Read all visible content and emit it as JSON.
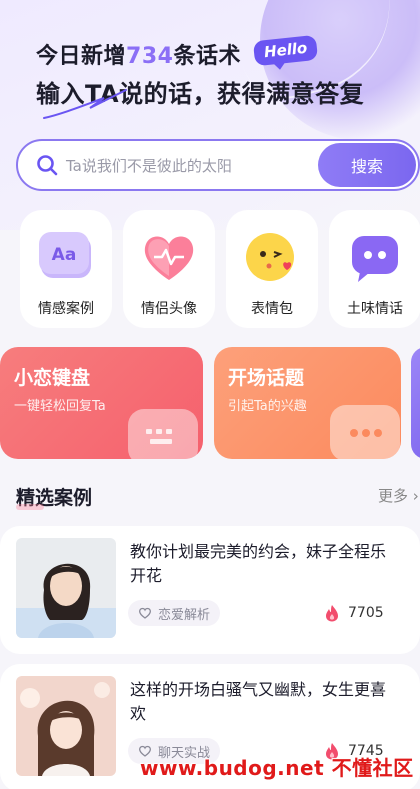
{
  "header": {
    "headline_prefix": "今日新增",
    "headline_count": "734",
    "headline_suffix": "条话术",
    "hello_badge": "Hello",
    "subheadline": "输入TA说的话，获得满意答复"
  },
  "search": {
    "placeholder": "Ta说我们不是彼此的太阳",
    "button_label": "搜索"
  },
  "categories": [
    {
      "label": "情感案例",
      "icon": "aa-text-icon"
    },
    {
      "label": "情侣头像",
      "icon": "heart-icon"
    },
    {
      "label": "表情包",
      "icon": "emoji-kiss-icon"
    },
    {
      "label": "土味情话",
      "icon": "chat-bubble-icon"
    }
  ],
  "promos": [
    {
      "title": "小恋键盘",
      "subtitle": "一键轻松回复Ta",
      "icon": "keyboard-icon"
    },
    {
      "title": "开场话题",
      "subtitle": "引起Ta的兴趣",
      "icon": "chat-dots-icon"
    }
  ],
  "featured": {
    "title": "精选案例",
    "more_label": "更多"
  },
  "cases": [
    {
      "title": "教你计划最完美的约会，妹子全程乐开花",
      "tag": "恋爱解析",
      "count": "7705"
    },
    {
      "title": "这样的开场白骚气又幽默，女生更喜欢",
      "tag": "聊天实战",
      "count": "7745"
    }
  ],
  "watermark": "www.budog.net 不懂社区",
  "colors": {
    "accent": "#8b6ff6",
    "search_border": "#8b78f0",
    "promo_red": "#f5606d",
    "promo_orange": "#fb8a5e",
    "watermark": "#e01a1a"
  }
}
